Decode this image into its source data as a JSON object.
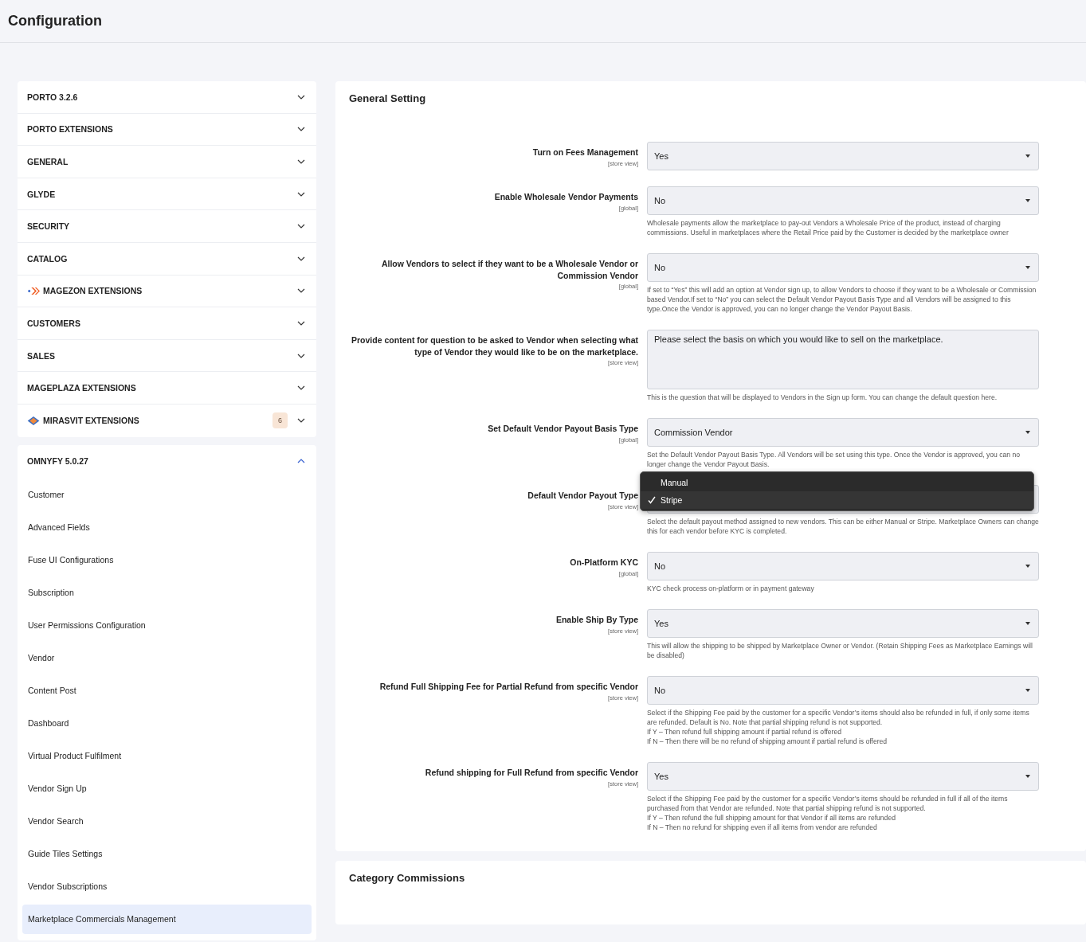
{
  "page_title": "Configuration",
  "sidebar": {
    "groups": [
      {
        "label": "PORTO 3.2.6",
        "expanded": false
      },
      {
        "label": "PORTO EXTENSIONS",
        "expanded": false
      },
      {
        "label": "GENERAL",
        "expanded": false
      },
      {
        "label": "GLYDE",
        "expanded": false
      },
      {
        "label": "SECURITY",
        "expanded": false
      },
      {
        "label": "CATALOG",
        "expanded": false
      },
      {
        "label": "MAGEZON EXTENSIONS",
        "expanded": false,
        "kind": "magezon"
      },
      {
        "label": "CUSTOMERS",
        "expanded": false
      },
      {
        "label": "SALES",
        "expanded": false
      },
      {
        "label": "MAGEPLAZA EXTENSIONS",
        "expanded": false
      },
      {
        "label": "MIRASVIT EXTENSIONS",
        "expanded": false,
        "kind": "mirasvit",
        "badge": "6"
      }
    ],
    "open_group": {
      "label": "OMNYFY 5.0.27",
      "expanded": true,
      "children": [
        {
          "label": "Customer",
          "selected": false
        },
        {
          "label": "Advanced Fields",
          "selected": false
        },
        {
          "label": "Fuse UI Configurations",
          "selected": false
        },
        {
          "label": "Subscription",
          "selected": false
        },
        {
          "label": "User Permissions Configuration",
          "selected": false
        },
        {
          "label": "Vendor",
          "selected": false
        },
        {
          "label": "Content Post",
          "selected": false
        },
        {
          "label": "Dashboard",
          "selected": false
        },
        {
          "label": "Virtual Product Fulfilment",
          "selected": false
        },
        {
          "label": "Vendor Sign Up",
          "selected": false
        },
        {
          "label": "Vendor Search",
          "selected": false
        },
        {
          "label": "Guide Tiles Settings",
          "selected": false
        },
        {
          "label": "Vendor Subscriptions",
          "selected": false
        },
        {
          "label": "Marketplace Commercials Management",
          "selected": true
        }
      ]
    }
  },
  "sections": [
    {
      "title": "General Setting",
      "fields": [
        {
          "kind": "select",
          "label": "Turn on Fees Management",
          "scope": "[store view]",
          "value": "Yes"
        },
        {
          "kind": "select",
          "label": "Enable Wholesale Vendor Payments",
          "scope": "[global]",
          "value": "No",
          "note": [
            "Wholesale payments allow the marketplace to pay-out Vendors a Wholesale Price of the product, instead of charging commissions. Useful in marketplaces where the Retail Price paid by the Customer is decided by the marketplace owner"
          ]
        },
        {
          "kind": "select",
          "label": "Allow Vendors to select if they want to be a Wholesale Vendor or Commission Vendor",
          "scope": "[global]",
          "value": "No",
          "note": [
            "If set to “Yes” this will add an option at Vendor sign up, to allow Vendors to choose if they want to be a Wholesale or Commission based Vendor.If set to “No” you can select the Default Vendor Payout Basis Type and all Vendors will be assigned to this type.Once the Vendor is approved, you can no longer change the Vendor Payout Basis."
          ]
        },
        {
          "kind": "textarea",
          "label": "Provide content for question to be asked to Vendor when selecting what type of Vendor they would like to be on the marketplace.",
          "scope": "[store view]",
          "value": "Please select the basis on which you would like to sell on the marketplace.",
          "note": [
            "This is the question that will be displayed to Vendors in the Sign up form. You can change the default question here."
          ]
        },
        {
          "kind": "select",
          "label": "Set Default Vendor Payout Basis Type",
          "scope": "[global]",
          "value": "Commission Vendor",
          "note": [
            "Set the Default Vendor Payout Basis Type. All Vendors will be set using this type. Once the Vendor is approved, you can no longer change the Vendor Payout Basis."
          ]
        },
        {
          "kind": "open_select",
          "label": "Default Vendor Payout Type",
          "scope": "[store view]",
          "options": [
            {
              "label": "Manual",
              "selected": false
            },
            {
              "label": "Stripe",
              "selected": true
            }
          ],
          "note": [
            "Select the default payout method assigned to new vendors. This can be either Manual or Stripe. Marketplace Owners can change this for each vendor before KYC is completed."
          ]
        },
        {
          "kind": "select",
          "label": "On-Platform KYC",
          "scope": "[global]",
          "value": "No",
          "note": [
            "KYC check process on-platform or in payment gateway"
          ]
        },
        {
          "kind": "select",
          "label": "Enable Ship By Type",
          "scope": "[store view]",
          "value": "Yes",
          "note": [
            "This will allow the shipping to be shipped by Marketplace Owner or Vendor. (Retain Shipping Fees as Marketplace Earnings will be disabled)"
          ]
        },
        {
          "kind": "select",
          "label": "Refund Full Shipping Fee for Partial Refund from specific Vendor",
          "scope": "[store view]",
          "value": "No",
          "note": [
            "Select if the Shipping Fee paid by the customer for a specific Vendor’s items should also be refunded in full, if only some items are refunded. Default is No. Note that partial shipping refund is not supported.",
            "If Y – Then refund full shipping amount if partial refund is offered",
            "If N – Then there will be no refund of shipping amount if partial refund is offered"
          ]
        },
        {
          "kind": "select",
          "label": "Refund shipping for Full Refund from specific Vendor",
          "scope": "[store view]",
          "value": "Yes",
          "note": [
            "Select if the Shipping Fee paid by the customer for a specific Vendor’s items should be refunded in full if all of the items purchased from that Vendor are refunded. Note that partial shipping refund is not supported.",
            "If Y – Then refund the full shipping amount for that Vendor if all items are refunded",
            "If N – Then no refund for shipping even if all items from vendor are refunded"
          ]
        }
      ]
    },
    {
      "title": "Category Commissions"
    }
  ]
}
